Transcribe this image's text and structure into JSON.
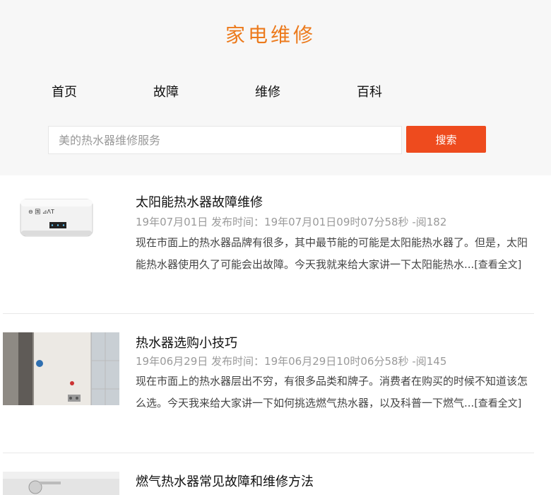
{
  "site": {
    "title": "家电维修"
  },
  "nav": {
    "items": [
      {
        "label": "首页"
      },
      {
        "label": "故障"
      },
      {
        "label": "维修"
      },
      {
        "label": "百科"
      }
    ]
  },
  "search": {
    "placeholder": "美的热水器维修服务",
    "button_label": "搜索"
  },
  "articles": [
    {
      "title": "太阳能热水器故障维修",
      "meta": "19年07月01日 发布时间：19年07月01日09时07分58秒 -阅182",
      "excerpt": "现在市面上的热水器品牌有很多，其中最节能的可能是太阳能热水器了。但是，太阳能热水器使用久了可能会出故障。今天我就来给大家讲一下太阳能热水...",
      "read_more": "[查看全文]",
      "thumb_logo": "⊖ 国 ⊿ΛΤ"
    },
    {
      "title": "热水器选购小技巧",
      "meta": "19年06月29日 发布时间：19年06月29日10时06分58秒 -阅145",
      "excerpt": "现在市面上的热水器层出不穷，有很多品类和牌子。消费者在购买的时候不知道该怎么选。今天我来给大家讲一下如何挑选燃气热水器，以及科普一下燃气...",
      "read_more": "[查看全文]"
    },
    {
      "title": "燃气热水器常见故障和维修方法"
    }
  ]
}
